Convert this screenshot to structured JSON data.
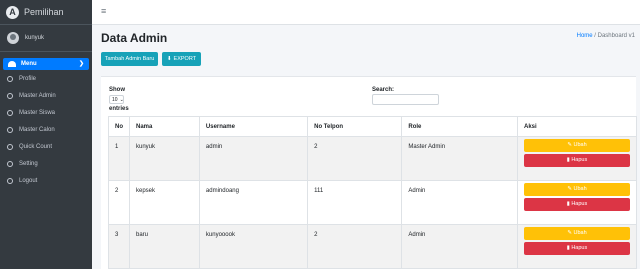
{
  "brand": {
    "name": "Pemilihan",
    "logo_glyph": "A"
  },
  "user": {
    "name": "kunyuk"
  },
  "sidebar": {
    "active": {
      "label": "Menu",
      "icon": "tachometer-icon",
      "chevron": "❯"
    },
    "items": [
      {
        "label": "Profile"
      },
      {
        "label": "Master Admin"
      },
      {
        "label": "Master Siswa"
      },
      {
        "label": "Master Calon"
      },
      {
        "label": "Quick Count"
      },
      {
        "label": "Setting"
      },
      {
        "label": "Logout"
      }
    ]
  },
  "navbar": {
    "toggle_glyph": "≡"
  },
  "header": {
    "title": "Data Admin",
    "breadcrumb": {
      "home": "Home",
      "separator": "/",
      "current": "Dashboard v1"
    }
  },
  "actions": {
    "add_label": "Tambah Admin Baru",
    "export_label": "EXPORT",
    "export_icon_glyph": "⬇"
  },
  "table_controls": {
    "show_label": "Show",
    "entries_value": "10",
    "select_glyph": "⌄",
    "entries_label": "entries",
    "search_label": "Search:",
    "search_value": ""
  },
  "table": {
    "columns": [
      "No",
      "Nama",
      "Username",
      "No Telpon",
      "Role",
      "Aksi"
    ],
    "rows": [
      {
        "no": "1",
        "nama": "kunyuk",
        "username": "admin",
        "telpon": "2",
        "role": "Master Admin"
      },
      {
        "no": "2",
        "nama": "kepsek",
        "username": "admindoang",
        "telpon": "111",
        "role": "Admin"
      },
      {
        "no": "3",
        "nama": "baru",
        "username": "kunyooook",
        "telpon": "2",
        "role": "Admin"
      }
    ],
    "edit_label": "✎ Ubah",
    "delete_label": "▮ Hapus"
  },
  "colors": {
    "primary": "#007bff",
    "info": "#17a2b8",
    "warning": "#ffc107",
    "danger": "#dc3545",
    "sidebar": "#343a40"
  }
}
